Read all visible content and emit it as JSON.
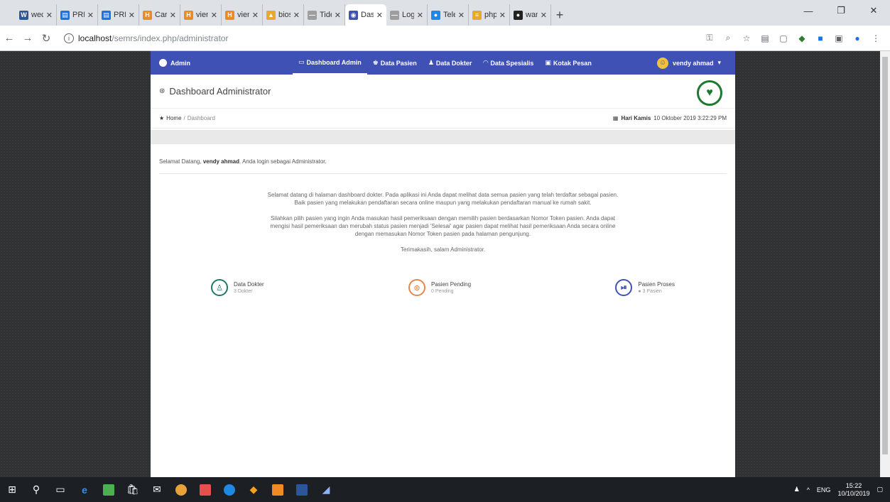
{
  "browser": {
    "tabs": [
      {
        "label": "wecg",
        "fav": "W",
        "color": "#2b579a"
      },
      {
        "label": "PRE",
        "fav": "▤",
        "color": "#1a73e8"
      },
      {
        "label": "PRE",
        "fav": "▤",
        "color": "#1a73e8"
      },
      {
        "label": "Cart",
        "fav": "H",
        "color": "#e88b2b"
      },
      {
        "label": "vien",
        "fav": "H",
        "color": "#e88b2b"
      },
      {
        "label": "vien",
        "fav": "H",
        "color": "#e88b2b"
      },
      {
        "label": "bios",
        "fav": "▲",
        "color": "#e8a82b"
      },
      {
        "label": "Tide",
        "fav": "—",
        "color": "#9e9e9e"
      },
      {
        "label": "Das",
        "fav": "◉",
        "color": "#3f51b5",
        "active": true
      },
      {
        "label": "Log",
        "fav": "—",
        "color": "#9e9e9e"
      },
      {
        "label": "Tele",
        "fav": "●",
        "color": "#1e88e5"
      },
      {
        "label": "php",
        "fav": "≡",
        "color": "#e8a82b"
      },
      {
        "label": "wan",
        "fav": "●",
        "color": "#222222"
      }
    ],
    "new_tab": "+",
    "url_host": "localhost",
    "url_path": "/semrs/index.php/administrator"
  },
  "app": {
    "brand": "Admin",
    "nav": [
      {
        "icon": "▭",
        "label": "Dashboard Admin",
        "active": true
      },
      {
        "icon": "♚",
        "label": "Data Pasien"
      },
      {
        "icon": "♟",
        "label": "Data Dokter"
      },
      {
        "icon": "◠",
        "label": "Data Spesialis"
      },
      {
        "icon": "▣",
        "label": "Kotak Pesan"
      }
    ],
    "user": "vendy ahmad",
    "page_title": "Dashboard Administrator",
    "breadcrumb": {
      "home": "Home",
      "sep": "/",
      "current": "Dashboard"
    },
    "date_label": "Hari Kamis",
    "date_value": "10 Oktober 2019 3:22:29 PM",
    "welcome": {
      "prefix": "Selamat Datang,",
      "name": "vendy ahmad",
      "suffix": ". Anda login sebagai Administrator."
    },
    "paragraphs": [
      "Selamat datang di halaman dashboard dokter. Pada aplikasi ini Anda dapat melihat data semua pasien yang telah terdaftar sebagai pasien. Baik pasien yang melakukan pendaftaran secara online maupun yang melakukan pendaftaran manual ke rumah sakit.",
      "Silahkan pilih pasien yang ingin Anda masukan hasil pemeriksaan dengan memilih pasien berdasarkan Nomor Token pasien. Anda dapat mengisi hasil pemeriksaan dan merubah status pasien menjadi 'Selesai' agar pasien dapat melihat hasil pemeriksaan Anda secara online dengan memasukan Nomor Token pasien pada halaman pengunjung.",
      "Terimakasih, salam Administrator."
    ],
    "stats": [
      {
        "name": "Data Dokter",
        "sub": "3 Dokter",
        "icon": "♙",
        "color": "#1b7a6a"
      },
      {
        "name": "Pasien Pending",
        "sub": "0 Pending",
        "icon": "⊙",
        "color": "#e8854a"
      },
      {
        "name": "Pasien Proses",
        "sub": "● 3 Pasien",
        "icon": "⏯",
        "color": "#3f51b5"
      }
    ]
  },
  "taskbar": {
    "lang": "ENG",
    "time": "15:22",
    "date": "10/10/2019"
  }
}
